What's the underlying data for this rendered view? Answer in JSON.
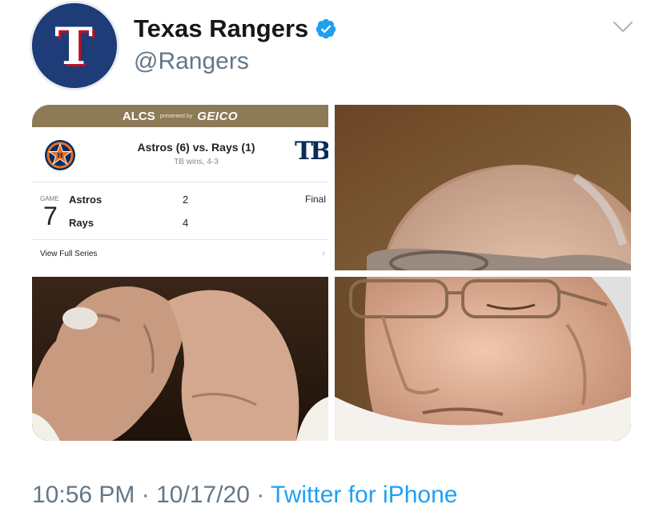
{
  "tweet": {
    "display_name": "Texas Rangers",
    "handle": "@Rangers",
    "avatar_letter": "T",
    "verified": true,
    "time": "10:56 PM",
    "date": "10/17/20",
    "separator": "·",
    "source": "Twitter for iPhone"
  },
  "scoreboard": {
    "series": "ALCS",
    "presented_by": "presented by",
    "sponsor": "GEICO",
    "matchup": "Astros (6) vs. Rays (1)",
    "result": "TB wins, 4-3",
    "rays_logo_text": "TB",
    "game_label": "GAME",
    "game_number": "7",
    "teams": [
      {
        "name": "Astros",
        "score": "2"
      },
      {
        "name": "Rays",
        "score": "4"
      }
    ],
    "status": "Final",
    "link": "View Full Series",
    "link_chevron": "›"
  },
  "icons": {
    "verified": "verified-badge-icon",
    "more": "chevron-down-icon",
    "astros": "astros-star-logo",
    "rays": "rays-tb-logo"
  },
  "colors": {
    "rangers_blue": "#1d3c78",
    "rangers_red": "#c0111f",
    "twitter_blue": "#1da1f2",
    "secondary_text": "#657786",
    "scoreboard_gold": "#8d7a57"
  }
}
